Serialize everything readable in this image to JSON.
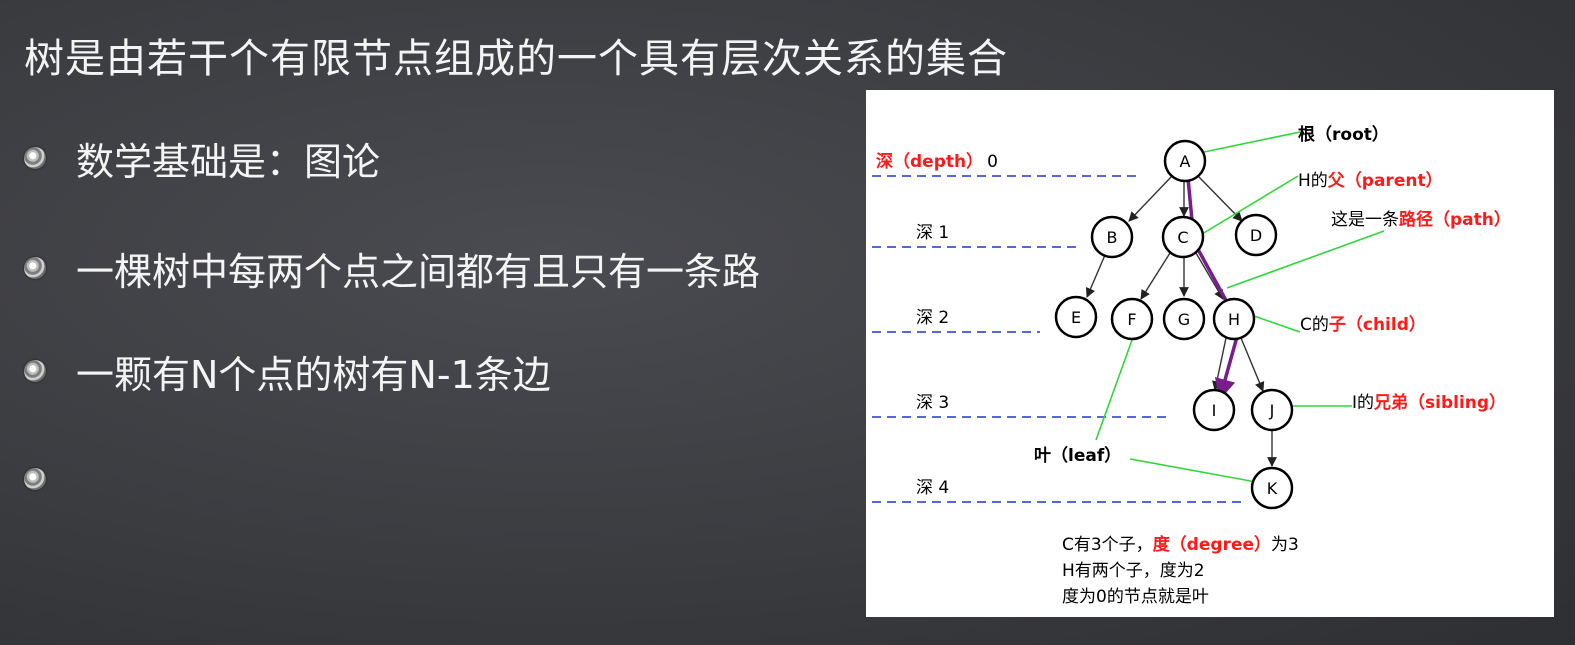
{
  "slide": {
    "title": "树是由若干个有限节点组成的一个具有层次关系的集合",
    "bullets": [
      "数学基础是：图论",
      "一棵树中每两个点之间都有且只有一条路",
      "一颗有N个点的树有N-1条边",
      ""
    ]
  },
  "diagram": {
    "nodes": [
      "A",
      "B",
      "C",
      "D",
      "E",
      "F",
      "G",
      "H",
      "I",
      "J",
      "K"
    ],
    "depth_labels": {
      "d0_red": "深（depth）",
      "d0_num": "0",
      "d1": "深 1",
      "d2": "深 2",
      "d3": "深 3",
      "d4": "深 4"
    },
    "annotations": {
      "root_red": "根（root）",
      "parent_prefix": "H的",
      "parent_red": "父（parent）",
      "path_prefix": "这是一条",
      "path_red": "路径（path）",
      "child_prefix": "C的",
      "child_red": "子（child）",
      "sibling_prefix": "I的",
      "sibling_red": "兄弟（sibling）",
      "leaf_red": "叶（leaf）"
    },
    "notes": {
      "line1_prefix": "C有3个子，",
      "line1_red": "度（degree）",
      "line1_suffix": "为3",
      "line2": "H有两个子，度为2",
      "line3": "度为0的节点就是叶"
    },
    "colors": {
      "highlight_red": "#ff1a1a",
      "pointer_green": "#2fd83a",
      "depth_dash_blue": "#1f37c9",
      "path_purple": "#7a1d8c"
    }
  }
}
